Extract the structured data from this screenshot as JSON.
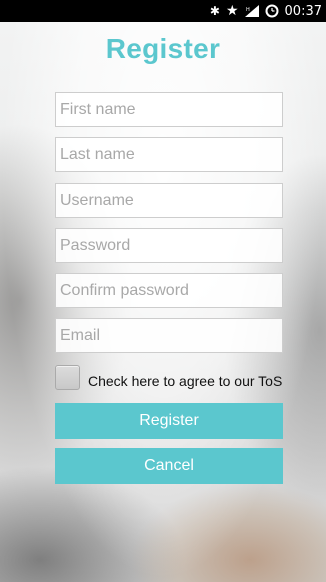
{
  "status_bar": {
    "time": "00:37",
    "icons": [
      "bluetooth-icon",
      "star-icon",
      "signal-icon",
      "alarm-icon"
    ],
    "bluetooth_glyph": "✱",
    "star_glyph": "★"
  },
  "form": {
    "title": "Register",
    "fields": {
      "first_name": {
        "placeholder": "First name",
        "value": ""
      },
      "last_name": {
        "placeholder": "Last name",
        "value": ""
      },
      "username": {
        "placeholder": "Username",
        "value": ""
      },
      "password": {
        "placeholder": "Password",
        "value": ""
      },
      "confirm_password": {
        "placeholder": "Confirm password",
        "value": ""
      },
      "email": {
        "placeholder": "Email",
        "value": ""
      }
    },
    "tos": {
      "label": "Check here to agree to our ToS",
      "checked": false
    },
    "register_label": "Register",
    "cancel_label": "Cancel"
  },
  "colors": {
    "accent": "#5bc7ce",
    "status_bar": "#000000",
    "button_text": "#ffffff"
  }
}
